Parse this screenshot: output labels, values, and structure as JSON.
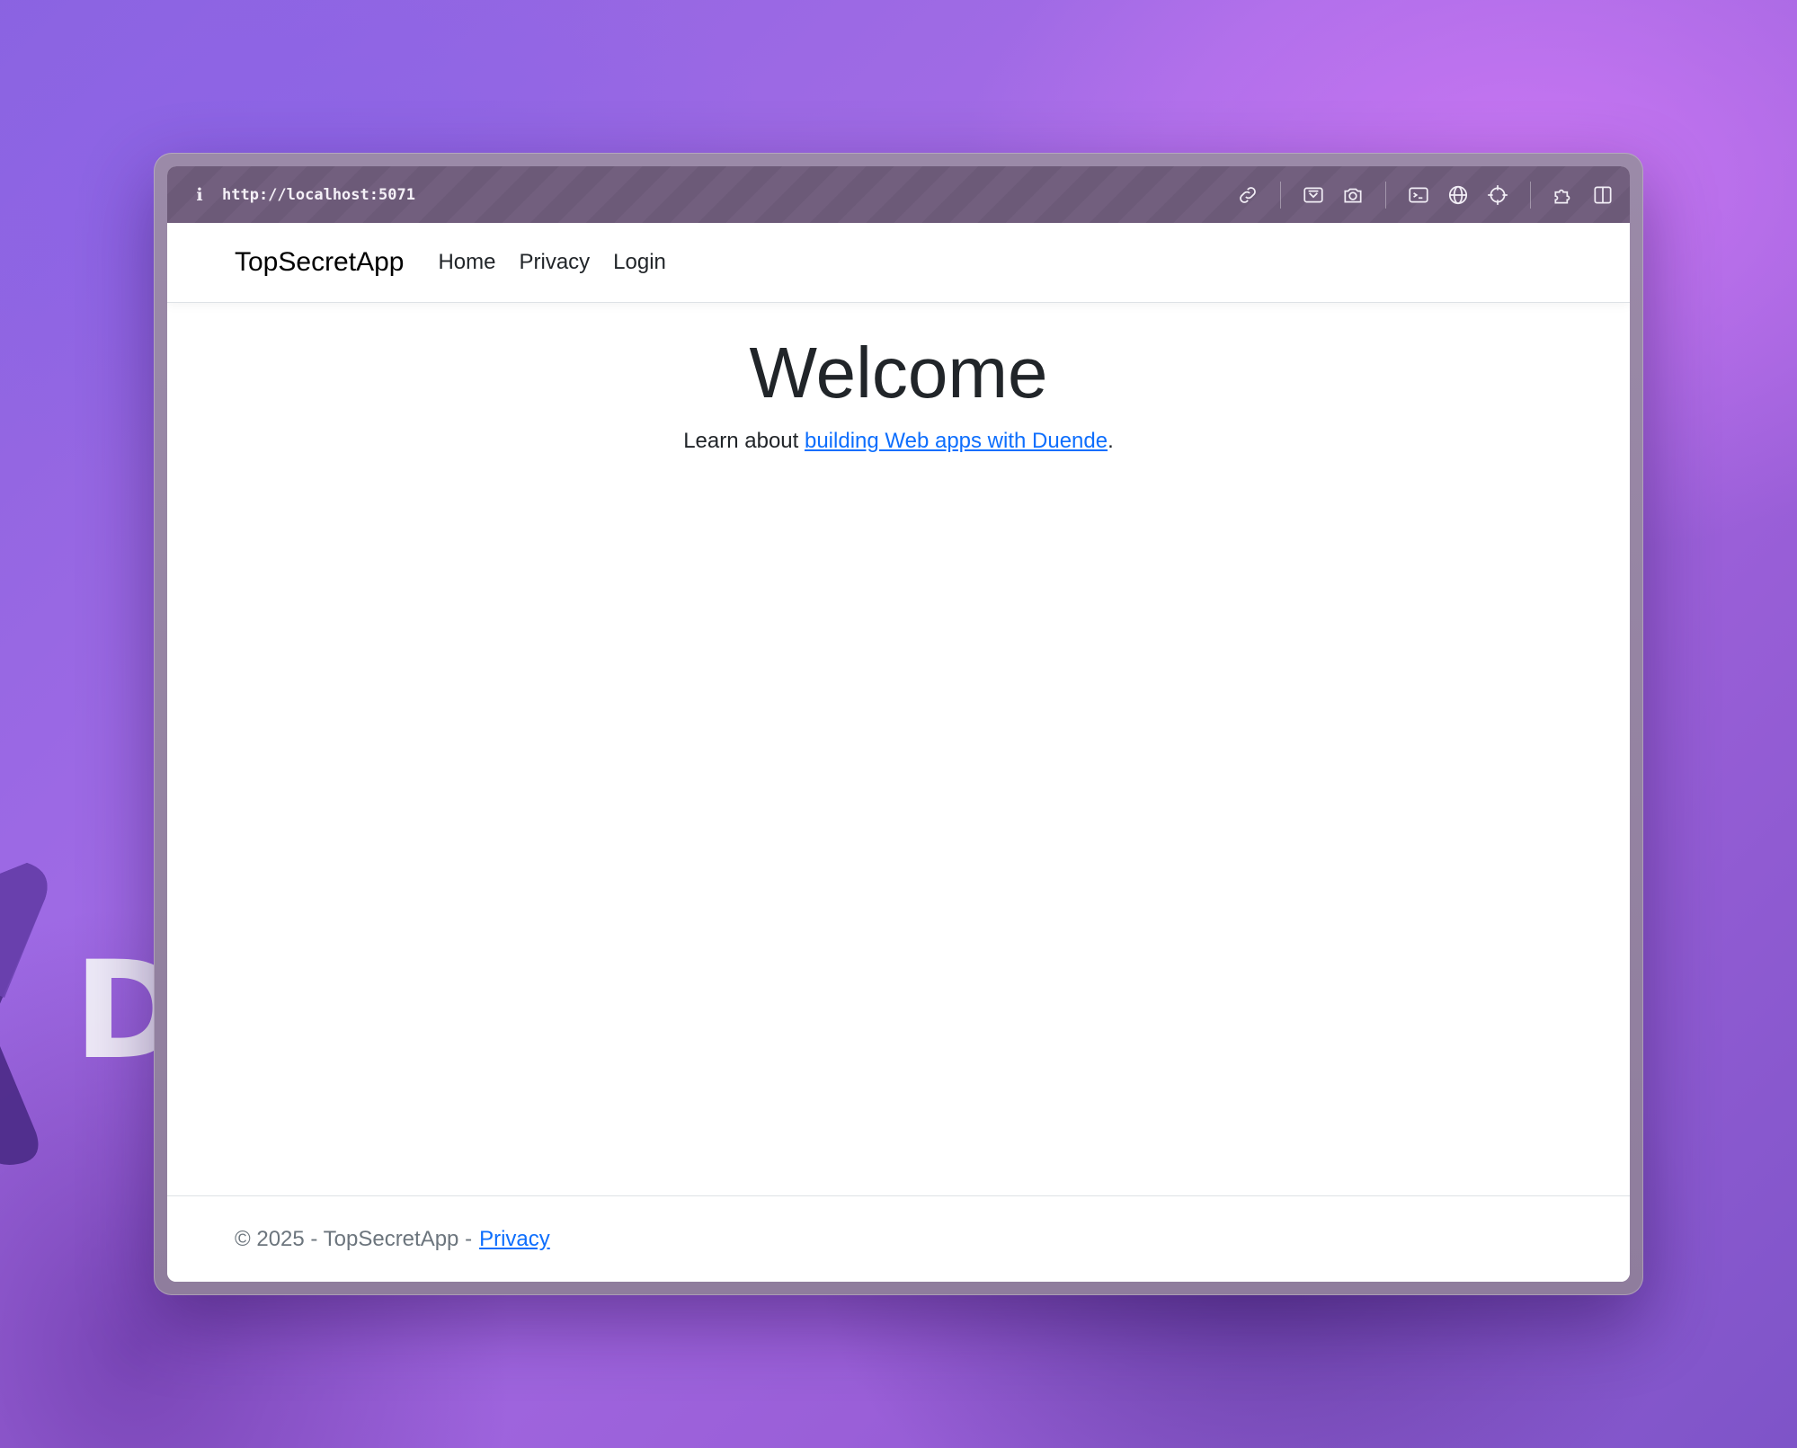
{
  "background": {
    "logo_letter": "D"
  },
  "browser": {
    "info_icon": "i",
    "url": "http://localhost:5071",
    "toolbar_icons": [
      "link-icon",
      "screenshot-area-icon",
      "camera-icon",
      "terminal-icon",
      "globe-icon",
      "crosshair-icon",
      "extension-icon",
      "sidebar-toggle-icon"
    ]
  },
  "nav": {
    "brand": "TopSecretApp",
    "links": [
      "Home",
      "Privacy",
      "Login"
    ]
  },
  "hero": {
    "title": "Welcome",
    "text_prefix": "Learn about ",
    "link_text": "building Web apps with Duende",
    "text_suffix": "."
  },
  "footer": {
    "text": "© 2025 - TopSecretApp -",
    "link": "Privacy"
  },
  "colors": {
    "link": "#0d6efd",
    "toolbar": "#725f7e",
    "text": "#212529",
    "footer_text": "#6c757d"
  }
}
